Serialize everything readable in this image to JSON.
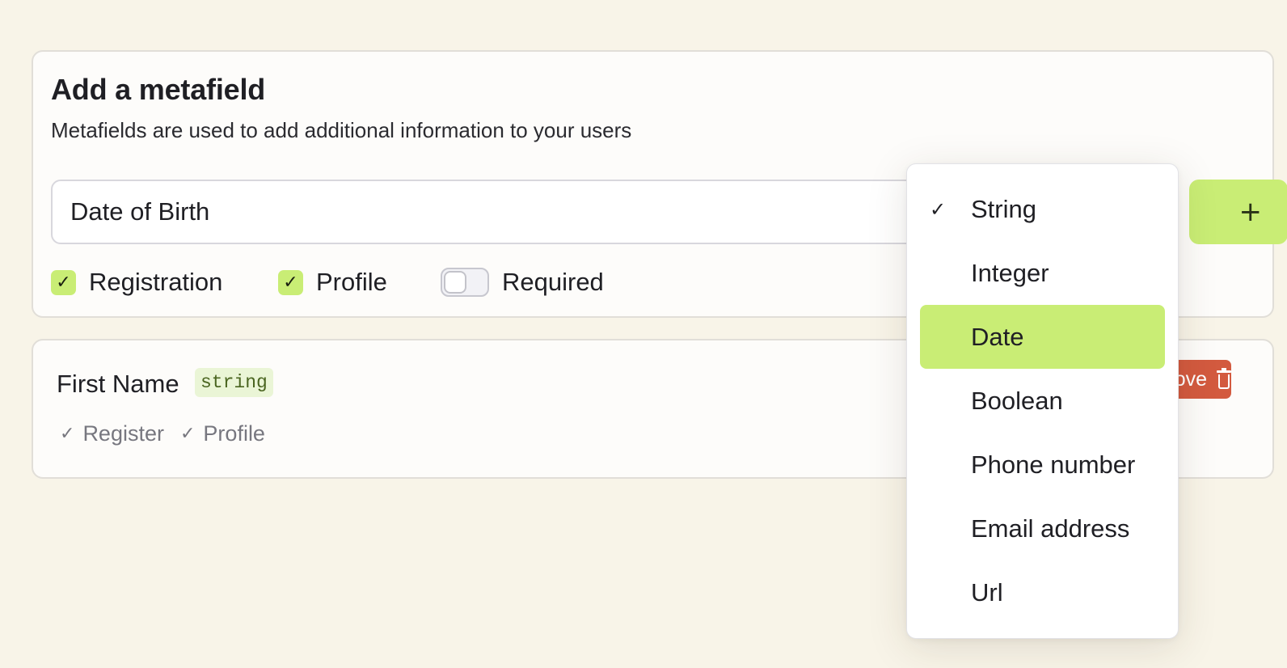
{
  "form": {
    "title": "Add a metafield",
    "subtitle": "Metafields are used to add additional information to your users",
    "name_value": "Date of Birth",
    "add_button_icon": "plus-icon",
    "add_button_symbol": "+",
    "options": [
      {
        "label": "Registration",
        "checked": true
      },
      {
        "label": "Profile",
        "checked": true
      },
      {
        "label": "Required",
        "checked": false
      }
    ],
    "check_symbol": "✓",
    "accent_color": "#c9ed75"
  },
  "fields": [
    {
      "name": "First Name",
      "type": "string",
      "flags": [
        {
          "label": "Register",
          "symbol": "✓"
        },
        {
          "label": "Profile",
          "symbol": "✓"
        }
      ],
      "remove_label": "Remove",
      "remove_icon": "trash-icon",
      "remove_color": "#d35a3f"
    }
  ],
  "type_dropdown": {
    "selected": "String",
    "highlighted": "Date",
    "check_symbol": "✓",
    "options": [
      "String",
      "Integer",
      "Date",
      "Boolean",
      "Phone number",
      "Email address",
      "Url"
    ]
  }
}
